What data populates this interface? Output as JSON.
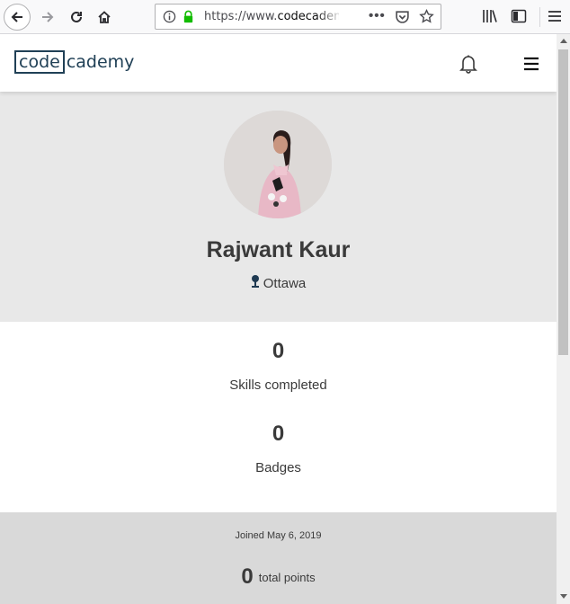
{
  "browser": {
    "url_prefix": "https://www.",
    "url_host": "codecadem",
    "url_more": "•••"
  },
  "site": {
    "logo_boxed": "code",
    "logo_rest": "cademy"
  },
  "profile": {
    "name": "Rajwant Kaur",
    "location": "Ottawa"
  },
  "stats": {
    "skills_count": "0",
    "skills_label": "Skills completed",
    "badges_count": "0",
    "badges_label": "Badges"
  },
  "summary": {
    "joined": "Joined May 6, 2019",
    "points_count": "0",
    "points_label": "total points"
  },
  "colors": {
    "brand": "#204056",
    "profile_bg": "#e8e8e8",
    "footer_bg": "#d9d9d9",
    "lock_green": "#12bc00"
  }
}
